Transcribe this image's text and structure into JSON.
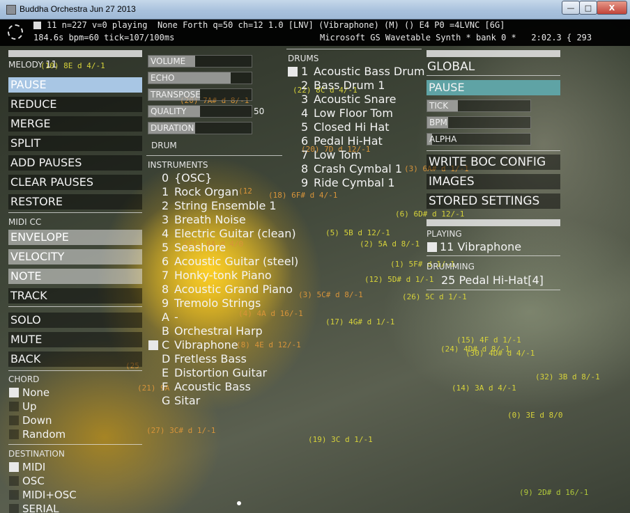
{
  "window": {
    "title": "Buddha Orchestra Jun 27 2013",
    "min_label": "—",
    "max_label": "□",
    "close_label": "X"
  },
  "header": {
    "line1": "11 n=227 v=0 playing  None Forth q=50 ch=12 1.0 [LNV] (Vibraphone) (M) () E4 P0 =4LVNC [6G]",
    "line2": "184.6s bpm=60 tick=107/100ms",
    "line3": "Microsoft GS Wavetable Synth * bank 0 *   2:02.3 { 293"
  },
  "left": {
    "melody_label": "MELODY",
    "melody_value": "11",
    "buttons": [
      "PAUSE",
      "REDUCE",
      "MERGE",
      "SPLIT",
      "ADD PAUSES",
      "CLEAR PAUSES",
      "RESTORE"
    ],
    "midi_cc_label": "MIDI CC",
    "cc_buttons": [
      "ENVELOPE",
      "VELOCITY",
      "NOTE",
      "TRACK"
    ],
    "mode_buttons": [
      "SOLO",
      "MUTE",
      "BACK"
    ],
    "chord_label": "CHORD",
    "chord_options": [
      "None",
      "Up",
      "Down",
      "Random"
    ],
    "destination_label": "DESTINATION",
    "destination_options": [
      "MIDI",
      "OSC",
      "MIDI+OSC",
      "SERIAL"
    ]
  },
  "mid": {
    "sliders": [
      {
        "label": "VOLUME",
        "fill": 0.45
      },
      {
        "label": "ECHO",
        "fill": 0.8
      },
      {
        "label": "TRANSPOSE",
        "fill": 0.5
      },
      {
        "label": "QUALITY",
        "fill": 0.5,
        "value": "50"
      },
      {
        "label": "DURATION",
        "fill": 0.45
      }
    ],
    "drum_label": "DRUM",
    "instruments_label": "INSTRUMENTS",
    "instruments": [
      {
        "idx": "0",
        "name": "{OSC}"
      },
      {
        "idx": "1",
        "name": "Rock Organ"
      },
      {
        "idx": "2",
        "name": "String Ensemble 1"
      },
      {
        "idx": "3",
        "name": "Breath Noise"
      },
      {
        "idx": "4",
        "name": "Electric Guitar (clean)"
      },
      {
        "idx": "5",
        "name": "Seashore"
      },
      {
        "idx": "6",
        "name": "Acoustic Guitar (steel)"
      },
      {
        "idx": "7",
        "name": "Honky-tonk Piano"
      },
      {
        "idx": "8",
        "name": "Acoustic Grand Piano"
      },
      {
        "idx": "9",
        "name": "Tremolo Strings"
      },
      {
        "idx": "A",
        "name": "-"
      },
      {
        "idx": "B",
        "name": "Orchestral Harp"
      },
      {
        "idx": "C",
        "name": "Vibraphone"
      },
      {
        "idx": "D",
        "name": "Fretless Bass"
      },
      {
        "idx": "E",
        "name": "Distortion Guitar"
      },
      {
        "idx": "F",
        "name": "Acoustic Bass"
      },
      {
        "idx": "G",
        "name": "Sitar"
      }
    ]
  },
  "drums": {
    "label": "DRUMS",
    "items": [
      {
        "idx": "1",
        "name": "Acoustic Bass Drum"
      },
      {
        "idx": "2",
        "name": "Bass Drum 1"
      },
      {
        "idx": "3",
        "name": "Acoustic Snare"
      },
      {
        "idx": "4",
        "name": "Low Floor Tom"
      },
      {
        "idx": "5",
        "name": "Closed Hi Hat"
      },
      {
        "idx": "6",
        "name": "Pedal Hi-Hat"
      },
      {
        "idx": "7",
        "name": "Low Tom"
      },
      {
        "idx": "8",
        "name": "Crash Cymbal 1"
      },
      {
        "idx": "9",
        "name": "Ride Cymbal 1"
      }
    ]
  },
  "right": {
    "global_label": "GLOBAL",
    "pause_label": "PAUSE",
    "sliders": [
      {
        "label": "TICK",
        "fill": 0.3
      },
      {
        "label": "BPM",
        "fill": 0.2
      },
      {
        "label": "ALPHA",
        "fill": 0.05
      }
    ],
    "buttons": [
      "WRITE BOC CONFIG",
      "IMAGES",
      "STORED SETTINGS"
    ],
    "playing_label": "PLAYING",
    "playing_value": "11 Vibraphone",
    "drumming_label": "DRUMMING",
    "drumming_value": "25 Pedal Hi-Hat[4]"
  },
  "notes": [
    "(10) 8E d 4/-1",
    "(20) 7A# d 8/-1",
    "(22) 8C d 4/-1",
    "(20) 7D d 12/-1",
    "(3) 6A# d 1/-1",
    "(18) 6F# d 4/-1",
    "(6) 6D# d 12/-1",
    "(5) 5B d 12/-1",
    "(2) 5A d 8/-1",
    "(1) 5F# d 1/-1",
    "(12) 5D# d 1/-1",
    "(3) 5C# d 8/-1",
    "(26) 5C d 1/-1",
    "(4) 4A d 16/-1",
    "(17) 4G# d 1/-1",
    "(8) 4E d 12/-1",
    "(15) 4F d 1/-1",
    "(24) 4D# d 8/-1",
    "(30) 4D# d 4/-1",
    "(32) 3B d 8/-1",
    "(14) 3A d 4/-1",
    "(0) 3E d 8/0",
    "(27) 3C# d 1/-1",
    "(19) 3C d 1/-1",
    "(9) 2D# d 16/-1",
    "(21) 6A d 4/0",
    "(12",
    "(25",
    "(21) 9A"
  ]
}
